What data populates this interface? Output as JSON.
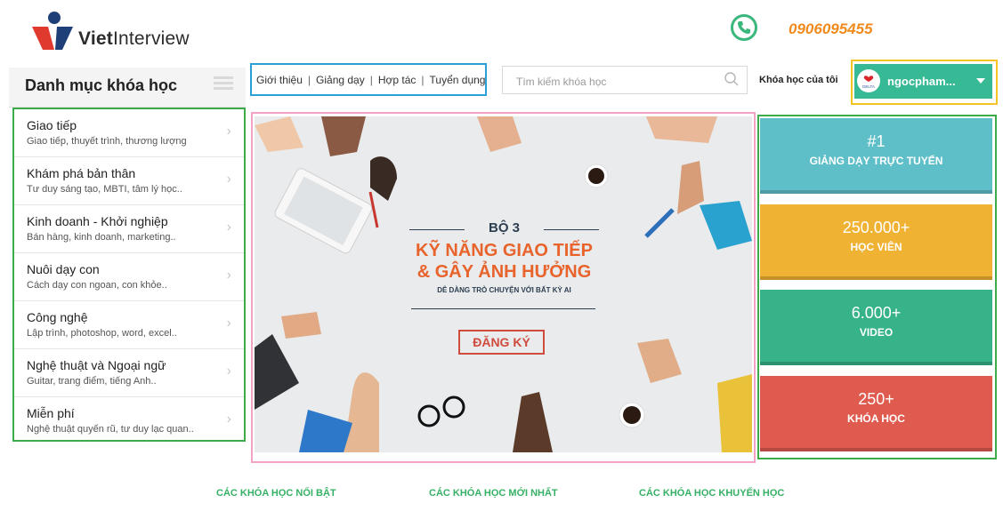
{
  "header": {
    "logo_text_bold": "Viet",
    "logo_text_rest": "Interview",
    "phone": "0906095455"
  },
  "categories": {
    "title": "Danh mục khóa học",
    "items": [
      {
        "label": "Giao tiếp",
        "sub": "Giao tiếp, thuyết trình, thương lượng"
      },
      {
        "label": "Khám phá bản thân",
        "sub": "Tư duy sáng tạo, MBTI, tâm lý học.."
      },
      {
        "label": "Kinh doanh - Khởi nghiệp",
        "sub": "Bán hàng, kinh doanh, marketing.."
      },
      {
        "label": "Nuôi dạy con",
        "sub": "Cách dạy con ngoan, con khỏe.."
      },
      {
        "label": "Công nghệ",
        "sub": "Lập trình, photoshop, word, excel.."
      },
      {
        "label": "Nghệ thuật và Ngoại ngữ",
        "sub": "Guitar, trang điểm, tiếng Anh.."
      },
      {
        "label": "Miễn phí",
        "sub": "Nghệ thuật quyến rũ, tư duy lạc quan.."
      }
    ]
  },
  "nav": {
    "links": [
      "Giới thiệu",
      "Giảng dạy",
      "Hợp tác",
      "Tuyển dụng"
    ],
    "separator": "|"
  },
  "search": {
    "placeholder": "Tìm kiếm khóa học"
  },
  "my_courses": "Khóa học của tôi",
  "user": {
    "name": "ngocpham...",
    "avatar_text": "DELTA"
  },
  "banner": {
    "line1": "BỘ 3",
    "line2": "KỸ NĂNG GIAO TIẾP",
    "line3": "& GÂY ẢNH HƯỞNG",
    "line4": "DỄ DÀNG TRÒ CHUYỆN VỚI BẤT KỲ AI",
    "cta": "ĐĂNG KÝ"
  },
  "stats": [
    {
      "big": "#1",
      "small": "GIẢNG DẠY TRỰC TUYẾN",
      "color": "#5fbfc9"
    },
    {
      "big": "250.000+",
      "small": "HỌC VIÊN",
      "color": "#f0b233"
    },
    {
      "big": "6.000+",
      "small": "VIDEO",
      "color": "#37b389"
    },
    {
      "big": "250+",
      "small": "KHÓA HỌC",
      "color": "#e05b4f"
    }
  ],
  "tabs": [
    "CÁC KHÓA HỌC NỔI BẬT",
    "CÁC KHÓA HỌC MỚI NHẤT",
    "CÁC KHÓA HỌC KHUYẾN HỌC"
  ],
  "colors": {
    "accent_green": "#36b994",
    "phone_orange": "#f08a1c",
    "nav_border": "#2aa0d8",
    "banner_border": "#f2a2c5",
    "cat_border": "#3cab4a",
    "user_border": "#f4c424"
  }
}
